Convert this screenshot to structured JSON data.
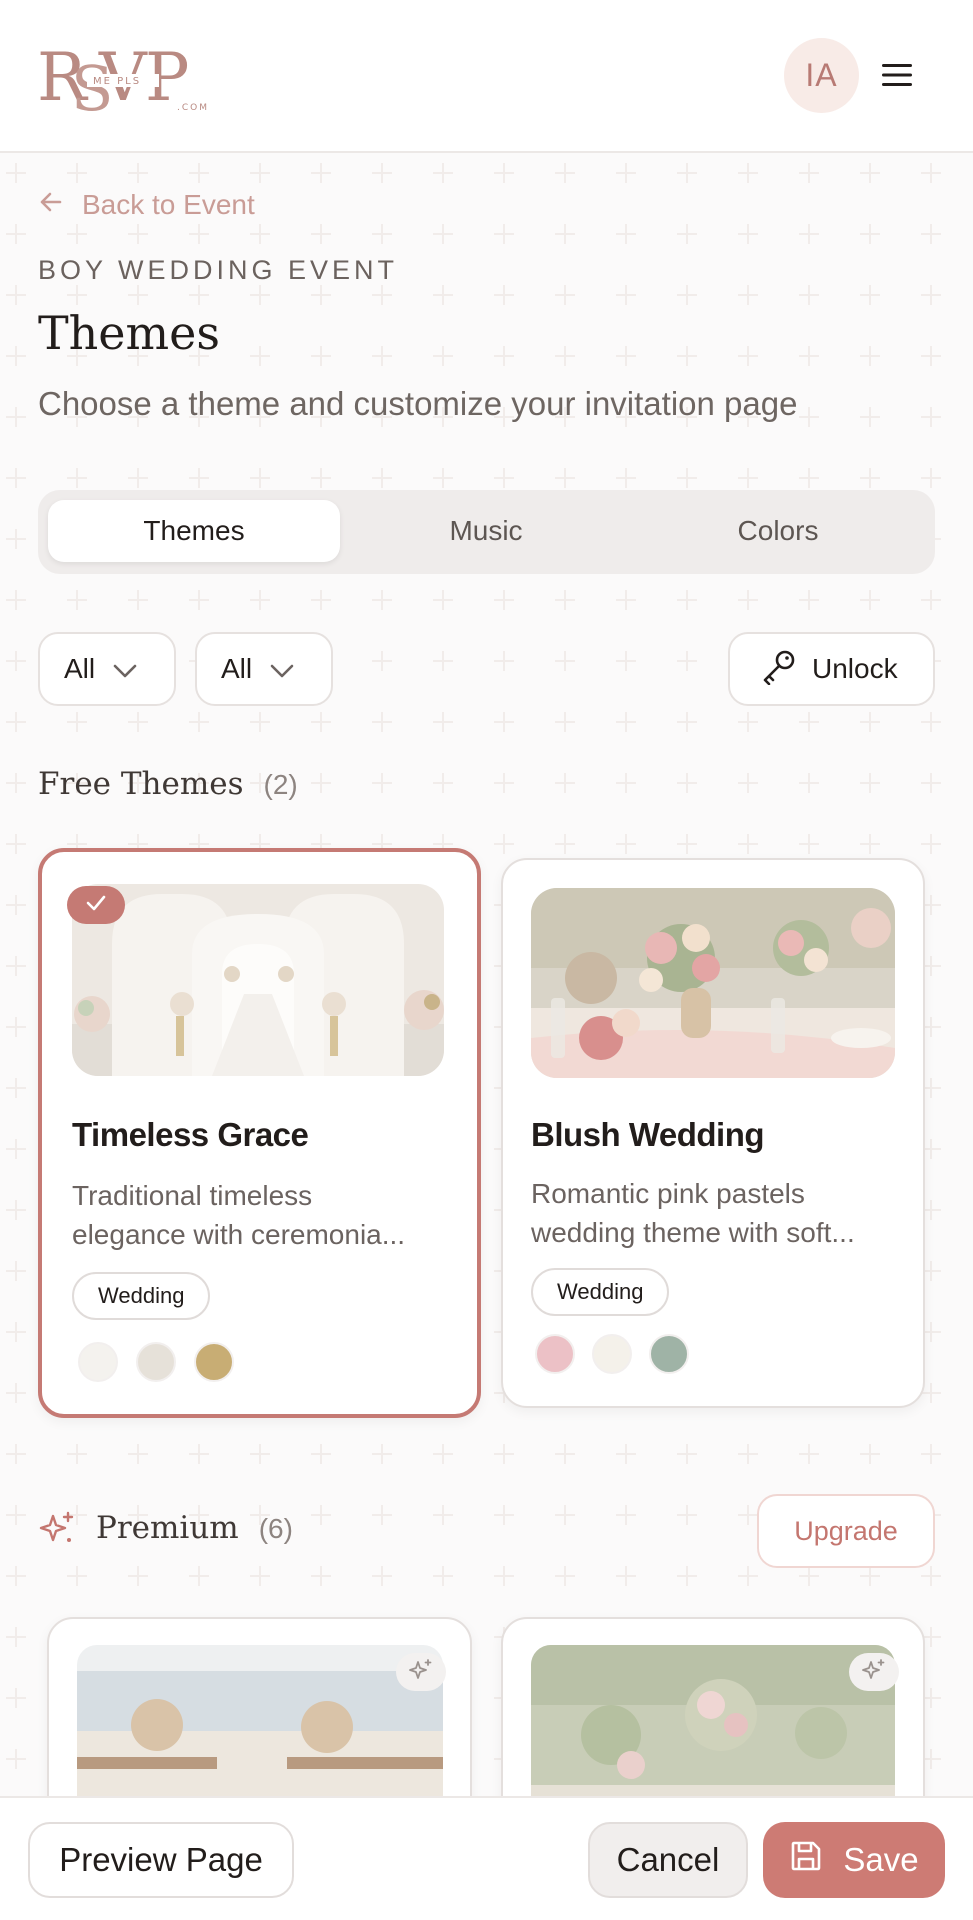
{
  "header": {
    "logo_text": "RSVP",
    "logo_sub": "ME PLS",
    "logo_domain": ".COM",
    "avatar_initials": "IA"
  },
  "nav": {
    "back_label": "Back to Event"
  },
  "page": {
    "eyebrow": "BOY WEDDING EVENT",
    "title": "Themes",
    "subtitle": "Choose a theme and customize your invitation page"
  },
  "tabs": [
    {
      "label": "Themes",
      "active": true
    },
    {
      "label": "Music",
      "active": false
    },
    {
      "label": "Colors",
      "active": false
    }
  ],
  "filters": {
    "filter_1": "All",
    "filter_2": "All",
    "unlock_label": "Unlock"
  },
  "free_section": {
    "title": "Free Themes",
    "count": "(2)",
    "themes": [
      {
        "title": "Timeless Grace",
        "desc_line_1": "Traditional timeless",
        "desc_line_2": "elegance with ceremonia...",
        "tag": "Wedding",
        "selected": true,
        "swatches": [
          "#f4f2ee",
          "#e6e1d9",
          "#c8ad74"
        ]
      },
      {
        "title": "Blush Wedding",
        "desc_line_1": "Romantic pink pastels",
        "desc_line_2": "wedding theme with soft...",
        "tag": "Wedding",
        "selected": false,
        "swatches": [
          "#ecc1c6",
          "#f4f1ea",
          "#9fb3a6"
        ]
      }
    ]
  },
  "premium_section": {
    "title": "Premium",
    "count": "(6)",
    "upgrade_label": "Upgrade"
  },
  "footer": {
    "preview_label": "Preview Page",
    "cancel_label": "Cancel",
    "save_label": "Save"
  },
  "colors": {
    "accent": "#cd7b74",
    "accent_light": "#f8ebe7",
    "text_dark": "#221d1b"
  },
  "icons": {
    "menu": "hamburger-icon",
    "back": "arrow-left-icon",
    "chevron": "chevron-down-icon",
    "key": "key-icon",
    "sparkle": "sparkles-icon",
    "check": "check-icon",
    "save": "floppy-disk-icon"
  }
}
